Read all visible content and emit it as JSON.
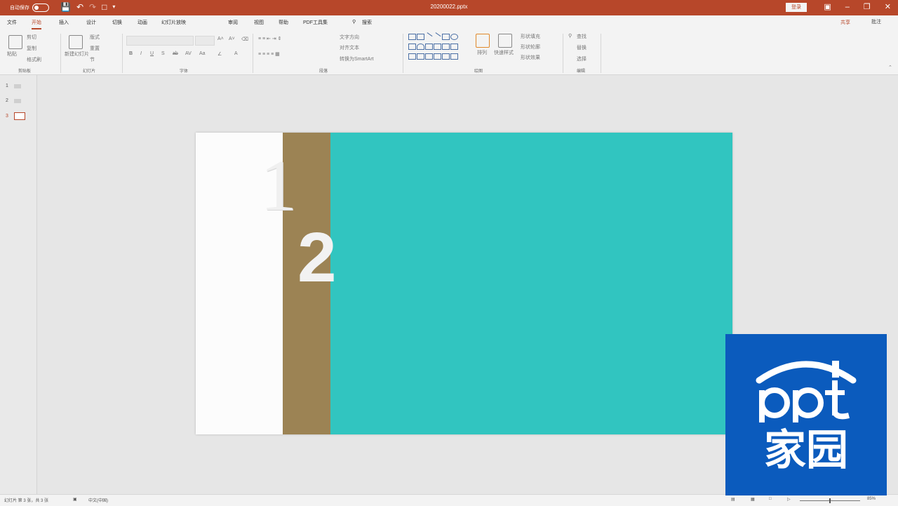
{
  "titlebar": {
    "autosave_label": "自动保存",
    "toggle_state": "关",
    "doc_title": "20200022.pptx",
    "signin": "登录",
    "window_controls": [
      "ribbon-display-icon",
      "minimize-icon",
      "restore-icon",
      "close-icon"
    ]
  },
  "tabs": [
    "文件",
    "开始",
    "插入",
    "设计",
    "切换",
    "动画",
    "幻灯片放映",
    "审阅",
    "视图",
    "帮助",
    "PDF工具集",
    "搜索"
  ],
  "active_tab": "开始",
  "share": "共享",
  "comment": "批注",
  "ribbon": {
    "clipboard": {
      "label": "剪贴板",
      "paste": "粘贴",
      "cut": "剪切",
      "copy": "复制",
      "painter": "格式刷"
    },
    "slides": {
      "label": "幻灯片",
      "new": "新建幻灯片",
      "layout": "版式",
      "reset": "重置",
      "section": "节"
    },
    "font": {
      "label": "字体"
    },
    "paragraph": {
      "label": "段落",
      "text_direction": "文字方向",
      "align_text": "对齐文本",
      "smartart": "转换为SmartArt"
    },
    "drawing": {
      "label": "绘图",
      "arrange": "排列",
      "quick_styles": "快速样式",
      "fill": "形状填充",
      "outline": "形状轮廓",
      "effects": "形状效果"
    },
    "editing": {
      "label": "编辑",
      "find": "查找",
      "replace": "替换",
      "select": "选择"
    }
  },
  "thumbnails": [
    {
      "num": "1",
      "selected": false
    },
    {
      "num": "2",
      "selected": false
    },
    {
      "num": "3",
      "selected": true
    }
  ],
  "slide": {
    "digit1": "1",
    "digit2": "2",
    "colors": {
      "left": "#fcfcfc",
      "brown": "#9c8354",
      "teal": "#31c5c0"
    }
  },
  "status": {
    "slide_info": "幻灯片 第 3 张，共 3 张",
    "language": "中文(中国)",
    "zoom": "85%"
  },
  "watermark": {
    "text_top": "ppt",
    "text_bottom": "家园",
    "color": "#0b5bbd"
  }
}
